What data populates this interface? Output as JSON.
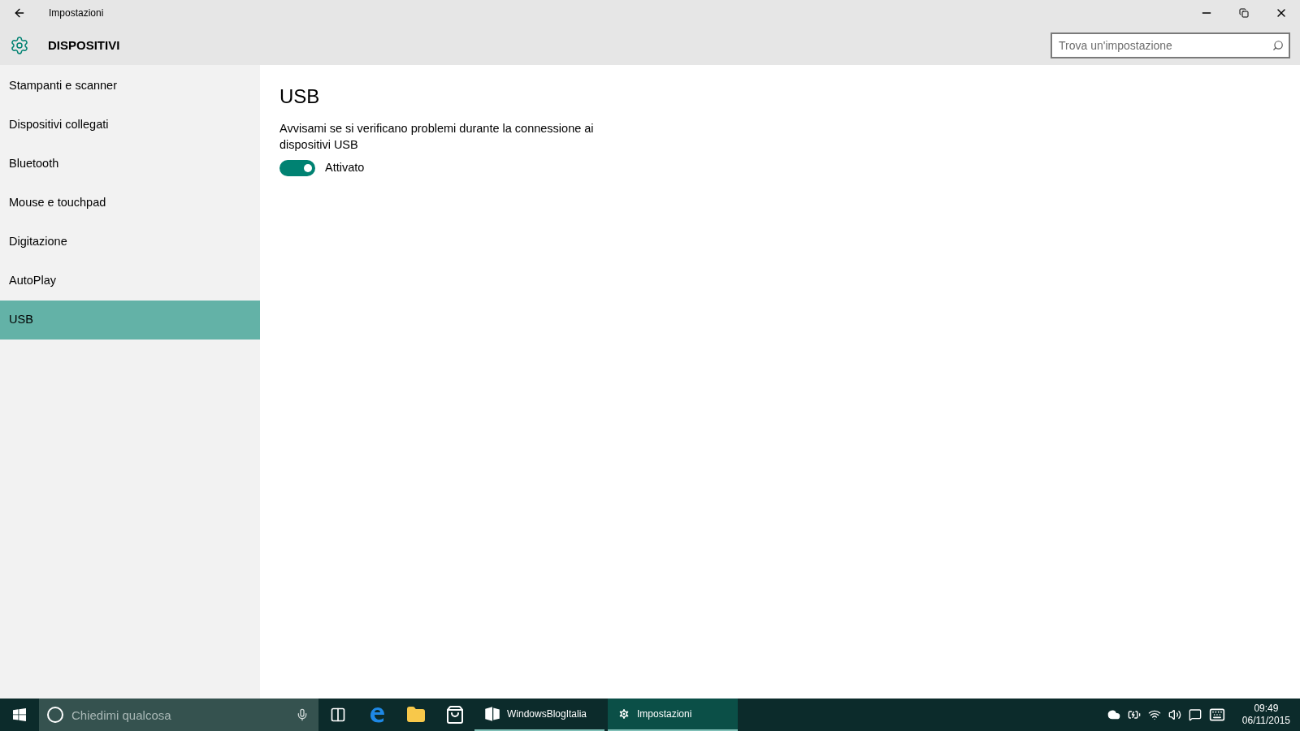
{
  "window": {
    "title": "Impostazioni"
  },
  "header": {
    "title": "DISPOSITIVI",
    "search": {
      "placeholder": "Trova un'impostazione"
    }
  },
  "sidebar": {
    "items": [
      {
        "label": "Stampanti e scanner",
        "selected": false
      },
      {
        "label": "Dispositivi collegati",
        "selected": false
      },
      {
        "label": "Bluetooth",
        "selected": false
      },
      {
        "label": "Mouse e touchpad",
        "selected": false
      },
      {
        "label": "Digitazione",
        "selected": false
      },
      {
        "label": "AutoPlay",
        "selected": false
      },
      {
        "label": "USB",
        "selected": true
      }
    ]
  },
  "content": {
    "title": "USB",
    "setting": {
      "description": "Avvisami se si verificano problemi durante la connessione ai dispositivi USB",
      "on": true,
      "state_label": "Attivato"
    }
  },
  "taskbar": {
    "search": {
      "placeholder": "Chiedimi qualcosa"
    },
    "apps": [
      {
        "kind": "taskview"
      },
      {
        "kind": "edge"
      },
      {
        "kind": "explorer"
      },
      {
        "kind": "store"
      },
      {
        "kind": "window",
        "label": "WindowsBlogItalia",
        "selected": false
      },
      {
        "kind": "settings",
        "label": "Impostazioni",
        "selected": true
      }
    ],
    "time": "09:49",
    "date": "06/11/2015"
  }
}
